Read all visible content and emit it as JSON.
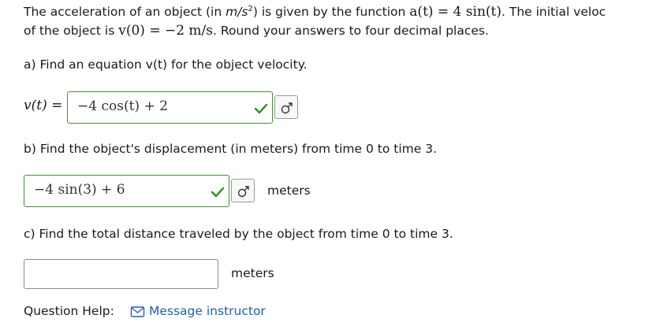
{
  "question": {
    "intro_part1": "The acceleration of an object (in ",
    "intro_units_m": "m/s",
    "intro_units_exp": "2",
    "intro_part2": ") is given by the function ",
    "intro_func": "a(t) = 4 sin(t)",
    "intro_part3": ". The initial veloc",
    "line2_part1": "of the object is ",
    "line2_initial": "v(0) = −2 m/s",
    "line2_part2": ". Round your answers to four decimal places."
  },
  "part_a": {
    "prompt": "a) Find an equation v(t) for the object velocity.",
    "label": "v(t) =",
    "answer": "−4 cos(t) + 2",
    "status": "correct"
  },
  "part_b": {
    "prompt": "b) Find the object's displacement (in meters) from time 0 to time 3.",
    "answer": "−4 sin(3) + 6",
    "units": "meters",
    "status": "correct"
  },
  "part_c": {
    "prompt": "c) Find the total distance traveled by the object from time 0 to time 3.",
    "answer": "",
    "units": "meters"
  },
  "help": {
    "label": "Question Help:",
    "link_label": "Message instructor"
  },
  "icons": {
    "check": "check-icon",
    "preview": "preview-icon",
    "mail": "mail-icon"
  },
  "colors": {
    "check": "#2e8b1e",
    "link": "#1f5fb5",
    "correct_border": "#4a8a3a"
  }
}
